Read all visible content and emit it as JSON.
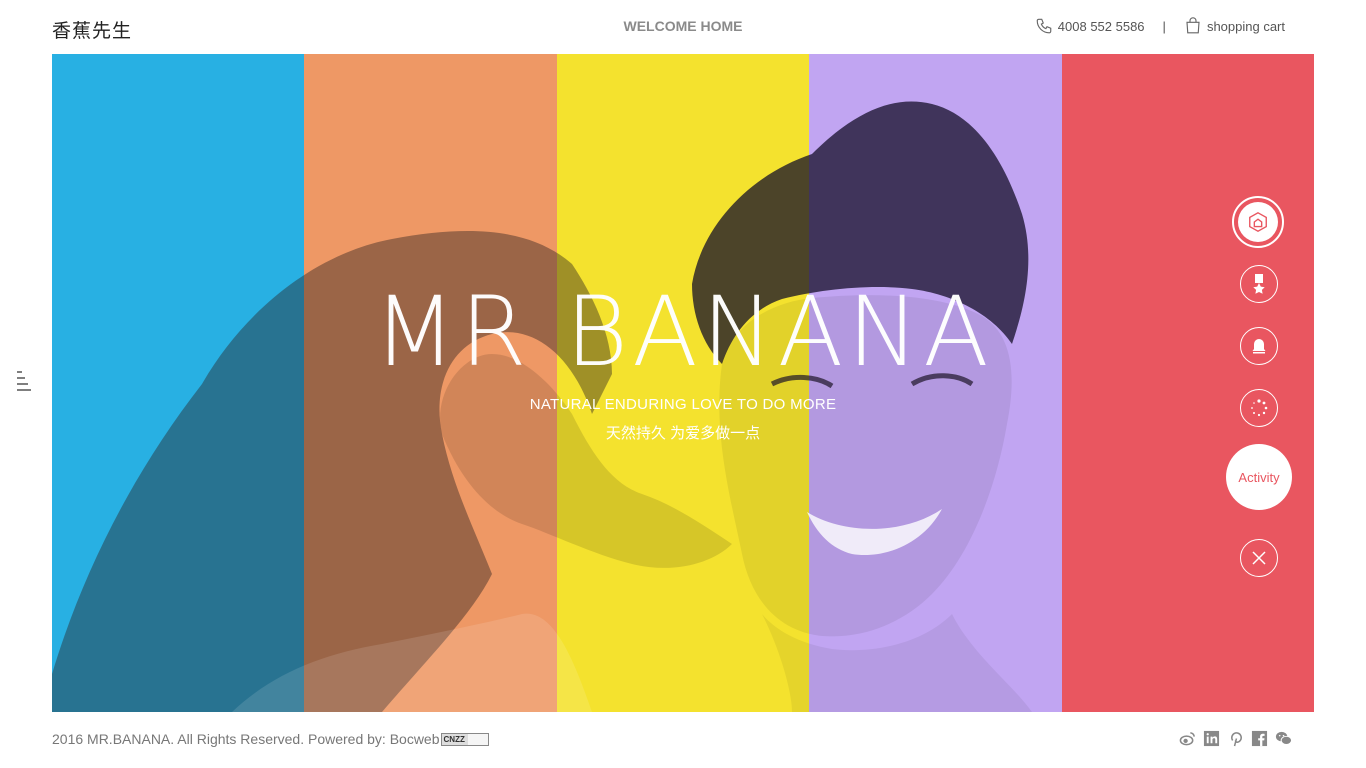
{
  "header": {
    "logo": "香蕉先生",
    "welcome": "WELCOME HOME",
    "phone": "4008 552 5586",
    "separator": "|",
    "cart": "shopping cart"
  },
  "hero": {
    "title": "MR BANANA",
    "tagline_en": "NATURAL ENDURING  LOVE TO DO MORE",
    "tagline_cn": "天然持久 为爱多做一点",
    "stripe_colors": [
      "#28b0e3",
      "#ee9865",
      "#f4e22e",
      "#c1a5f2",
      "#e95660"
    ]
  },
  "side_nav": {
    "items": [
      {
        "icon": "home-icon"
      },
      {
        "icon": "award-icon"
      },
      {
        "icon": "bell-icon"
      },
      {
        "icon": "loading-icon"
      },
      {
        "label": "Activity"
      },
      {
        "icon": "close-icon"
      }
    ]
  },
  "footer": {
    "copyright": "2016 MR.BANANA. All Rights Reserved. Powered by: Bocweb",
    "badge": "CNZZ",
    "social": [
      "weibo-icon",
      "linkedin-icon",
      "pinterest-icon",
      "facebook-icon",
      "wechat-icon"
    ]
  }
}
